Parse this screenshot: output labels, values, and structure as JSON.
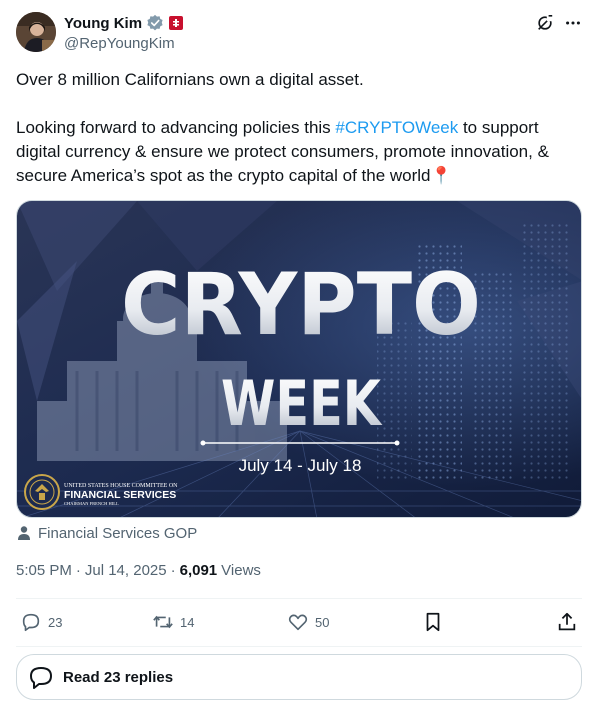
{
  "author": {
    "display_name": "Young Kim",
    "handle": "@RepYoungKim",
    "verified_icon": "verified-badge-icon",
    "flag_icon": "government-flag-icon"
  },
  "tweet": {
    "line1": "Over 8 million Californians own a digital asset.",
    "body_before_tag": "Looking forward to advancing policies this ",
    "hashtag": "#CRYPTOWeek",
    "body_after_tag": " to support digital currency & ensure we protect consumers, promote innovation, & secure America’s spot as the crypto capital of the world",
    "emoji": "📍"
  },
  "media": {
    "title_big": "CRYPTO",
    "title_small": "WEEK",
    "dates": "July 14 - July 18",
    "logo_line1": "UNITED STATES HOUSE COMMITTEE ON",
    "logo_line2": "FINANCIAL SERVICES",
    "logo_line3": "CHAIRMAN FRENCH HILL"
  },
  "credit": {
    "label": "Financial Services GOP"
  },
  "meta": {
    "time": "5:05 PM",
    "separator": "·",
    "date": "Jul 14, 2025",
    "views_count": "6,091",
    "views_label": "Views"
  },
  "stats": {
    "replies": "23",
    "reposts": "14",
    "likes": "50"
  },
  "read_replies": {
    "label": "Read 23 replies"
  },
  "colors": {
    "accent": "#1d9bf0",
    "secondary_text": "#536471",
    "border": "#cfd9de"
  }
}
